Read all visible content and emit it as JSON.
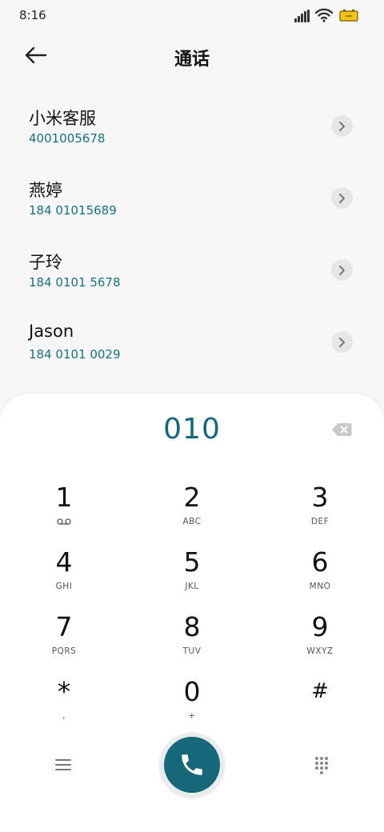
{
  "status_bar": {
    "time": "8:16",
    "icons": [
      "signal-icon",
      "wifi-icon",
      "battery-icon"
    ],
    "battery_color": "#f1c21b"
  },
  "header": {
    "title": "通话",
    "back_icon": "back-arrow-icon"
  },
  "contacts": [
    {
      "name": "小米客服",
      "number": "4001005678"
    },
    {
      "name": "燕婷",
      "number": "184 01015689"
    },
    {
      "name": "子玲",
      "number": "184 0101 5678"
    },
    {
      "name": "Jason",
      "number": "184 0101 0029"
    }
  ],
  "dialer": {
    "input_value": "010",
    "delete_icon": "backspace-icon",
    "keys": [
      {
        "digit": "1",
        "letters": "",
        "sub_icon": "voicemail-icon"
      },
      {
        "digit": "2",
        "letters": "ABC"
      },
      {
        "digit": "3",
        "letters": "DEF"
      },
      {
        "digit": "4",
        "letters": "GHI"
      },
      {
        "digit": "5",
        "letters": "JKL"
      },
      {
        "digit": "6",
        "letters": "MNO"
      },
      {
        "digit": "7",
        "letters": "PQRS"
      },
      {
        "digit": "8",
        "letters": "TUV"
      },
      {
        "digit": "9",
        "letters": "WXYZ"
      },
      {
        "digit": "*",
        "letters": ","
      },
      {
        "digit": "0",
        "letters": "+"
      },
      {
        "digit": "#",
        "letters": ""
      }
    ],
    "bottom_icons": [
      "menu-icon",
      "phone-icon",
      "keypad-icon"
    ],
    "accent_color": "#166777"
  }
}
